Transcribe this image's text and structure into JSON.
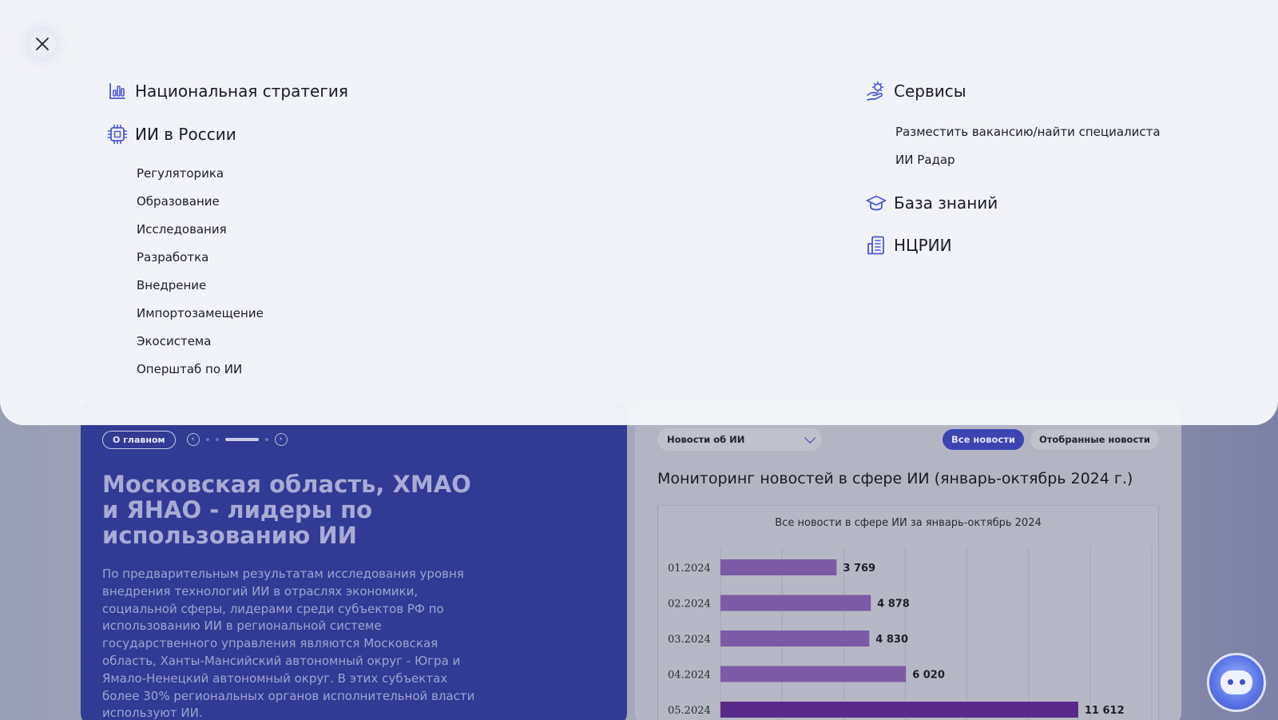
{
  "menu": {
    "left_sections": [
      {
        "label": "Национальная стратегия",
        "icon": "bar-chart-icon"
      },
      {
        "label": "ИИ в России",
        "icon": "chip-icon"
      }
    ],
    "ai_russia_items": [
      "Регуляторика",
      "Образование",
      "Исследования",
      "Разработка",
      "Внедрение",
      "Импортозамещение",
      "Экосистема",
      "Оперштаб по ИИ"
    ],
    "services": {
      "label": "Сервисы",
      "icon": "hand-gear-icon"
    },
    "services_items": [
      "Разместить вакансию/найти специалиста",
      "ИИ Радар"
    ],
    "knowledge": {
      "label": "База знаний",
      "icon": "graduation-cap-icon"
    },
    "ncrii": {
      "label": "НЦРИИ",
      "icon": "building-icon"
    }
  },
  "hero": {
    "badge": "О главном",
    "title": "Московская область, ХМАО и ЯНАО - лидеры по использованию ИИ",
    "text": "По предварительным результатам исследования уровня внедрения технологий ИИ в отраслях экономики, социальной сферы, лидерами среди субъектов РФ по использованию ИИ в региональной системе государственного управления являются Московская область, Ханты-Мансийский автономный округ - Югра и Ямало-Ненецкий автономный округ. В этих субъектах более 30% региональных органов исполнительной власти используют ИИ."
  },
  "news": {
    "select_value": "Новости об ИИ",
    "tab_all": "Все новости",
    "tab_selected": "Отобранные новости",
    "title": "Мониторинг новостей в сфере ИИ (январь-октябрь 2024 г.)"
  },
  "colors": {
    "accent": "#3b45b1",
    "hero_bg": "#313b94",
    "bar": "#7b5aa6",
    "bar_dark": "#5a2a8a",
    "icon": "#4a57d6"
  },
  "chart_data": {
    "type": "bar",
    "orientation": "horizontal",
    "title": "Все новости в сфере ИИ за январь-октябрь 2024",
    "categories": [
      "01.2024",
      "02.2024",
      "03.2024",
      "04.2024",
      "05.2024"
    ],
    "values": [
      3769,
      4878,
      4830,
      6020,
      11612
    ],
    "value_labels": [
      "3 769",
      "4 878",
      "4 830",
      "6 020",
      "11 612"
    ],
    "xlim": [
      0,
      14000
    ],
    "grid": true
  }
}
